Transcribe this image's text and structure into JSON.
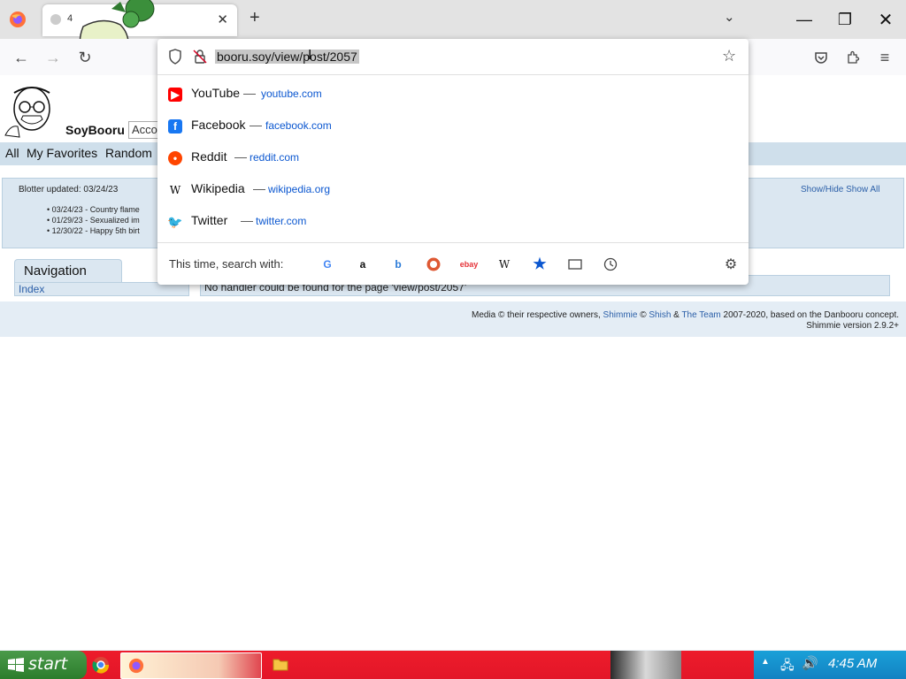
{
  "browser": {
    "tab_title": "4",
    "url": "booru.soy/view/post/2057"
  },
  "site": {
    "title": "SoyBooru",
    "account_placeholder": "Acco",
    "nav_links": [
      "All",
      "My Favorites",
      "Random"
    ],
    "blotter": {
      "updated": "Blotter updated: 03/24/23",
      "items": [
        "03/24/23 - Country flame",
        "01/29/23 - Sexualized im",
        "12/30/22 - Happy 5th birt"
      ],
      "toggle": "Show/Hide Show All"
    },
    "navigation": {
      "title": "Navigation",
      "index_link": "Index"
    },
    "message": "No handler could be found for the page 'view/post/2057'",
    "footer": {
      "text_a": "Media © their respective owners, ",
      "link_shimmie": "Shimmie",
      "text_b": " © ",
      "link_shish": "Shish",
      "text_c": " & ",
      "link_team": "The Team",
      "text_d": " 2007-2020, based on the Danbooru concept.",
      "version": "Shimmie version 2.9.2+"
    }
  },
  "suggestions": [
    {
      "name": "YouTube",
      "url": "youtube.com",
      "icon": "youtube-icon",
      "color": "#ff0000"
    },
    {
      "name": "Facebook",
      "url": "facebook.com",
      "icon": "facebook-icon",
      "color": "#1877f2"
    },
    {
      "name": "Reddit",
      "url": "reddit.com",
      "icon": "reddit-icon",
      "color": "#ff4500"
    },
    {
      "name": "Wikipedia",
      "url": "wikipedia.org",
      "icon": "wikipedia-icon",
      "color": "#000000"
    },
    {
      "name": "Twitter",
      "url": "twitter.com",
      "icon": "twitter-icon",
      "color": "#1d9bf0"
    }
  ],
  "search_with": {
    "label": "This time, search with:",
    "engines": [
      "google-icon",
      "amazon-icon",
      "bing-icon",
      "duckduckgo-icon",
      "ebay-icon",
      "wikipedia-icon",
      "bookmarks-icon",
      "tabs-icon",
      "history-icon"
    ]
  },
  "taskbar": {
    "start_label": "start",
    "clock": "4:45 AM"
  }
}
